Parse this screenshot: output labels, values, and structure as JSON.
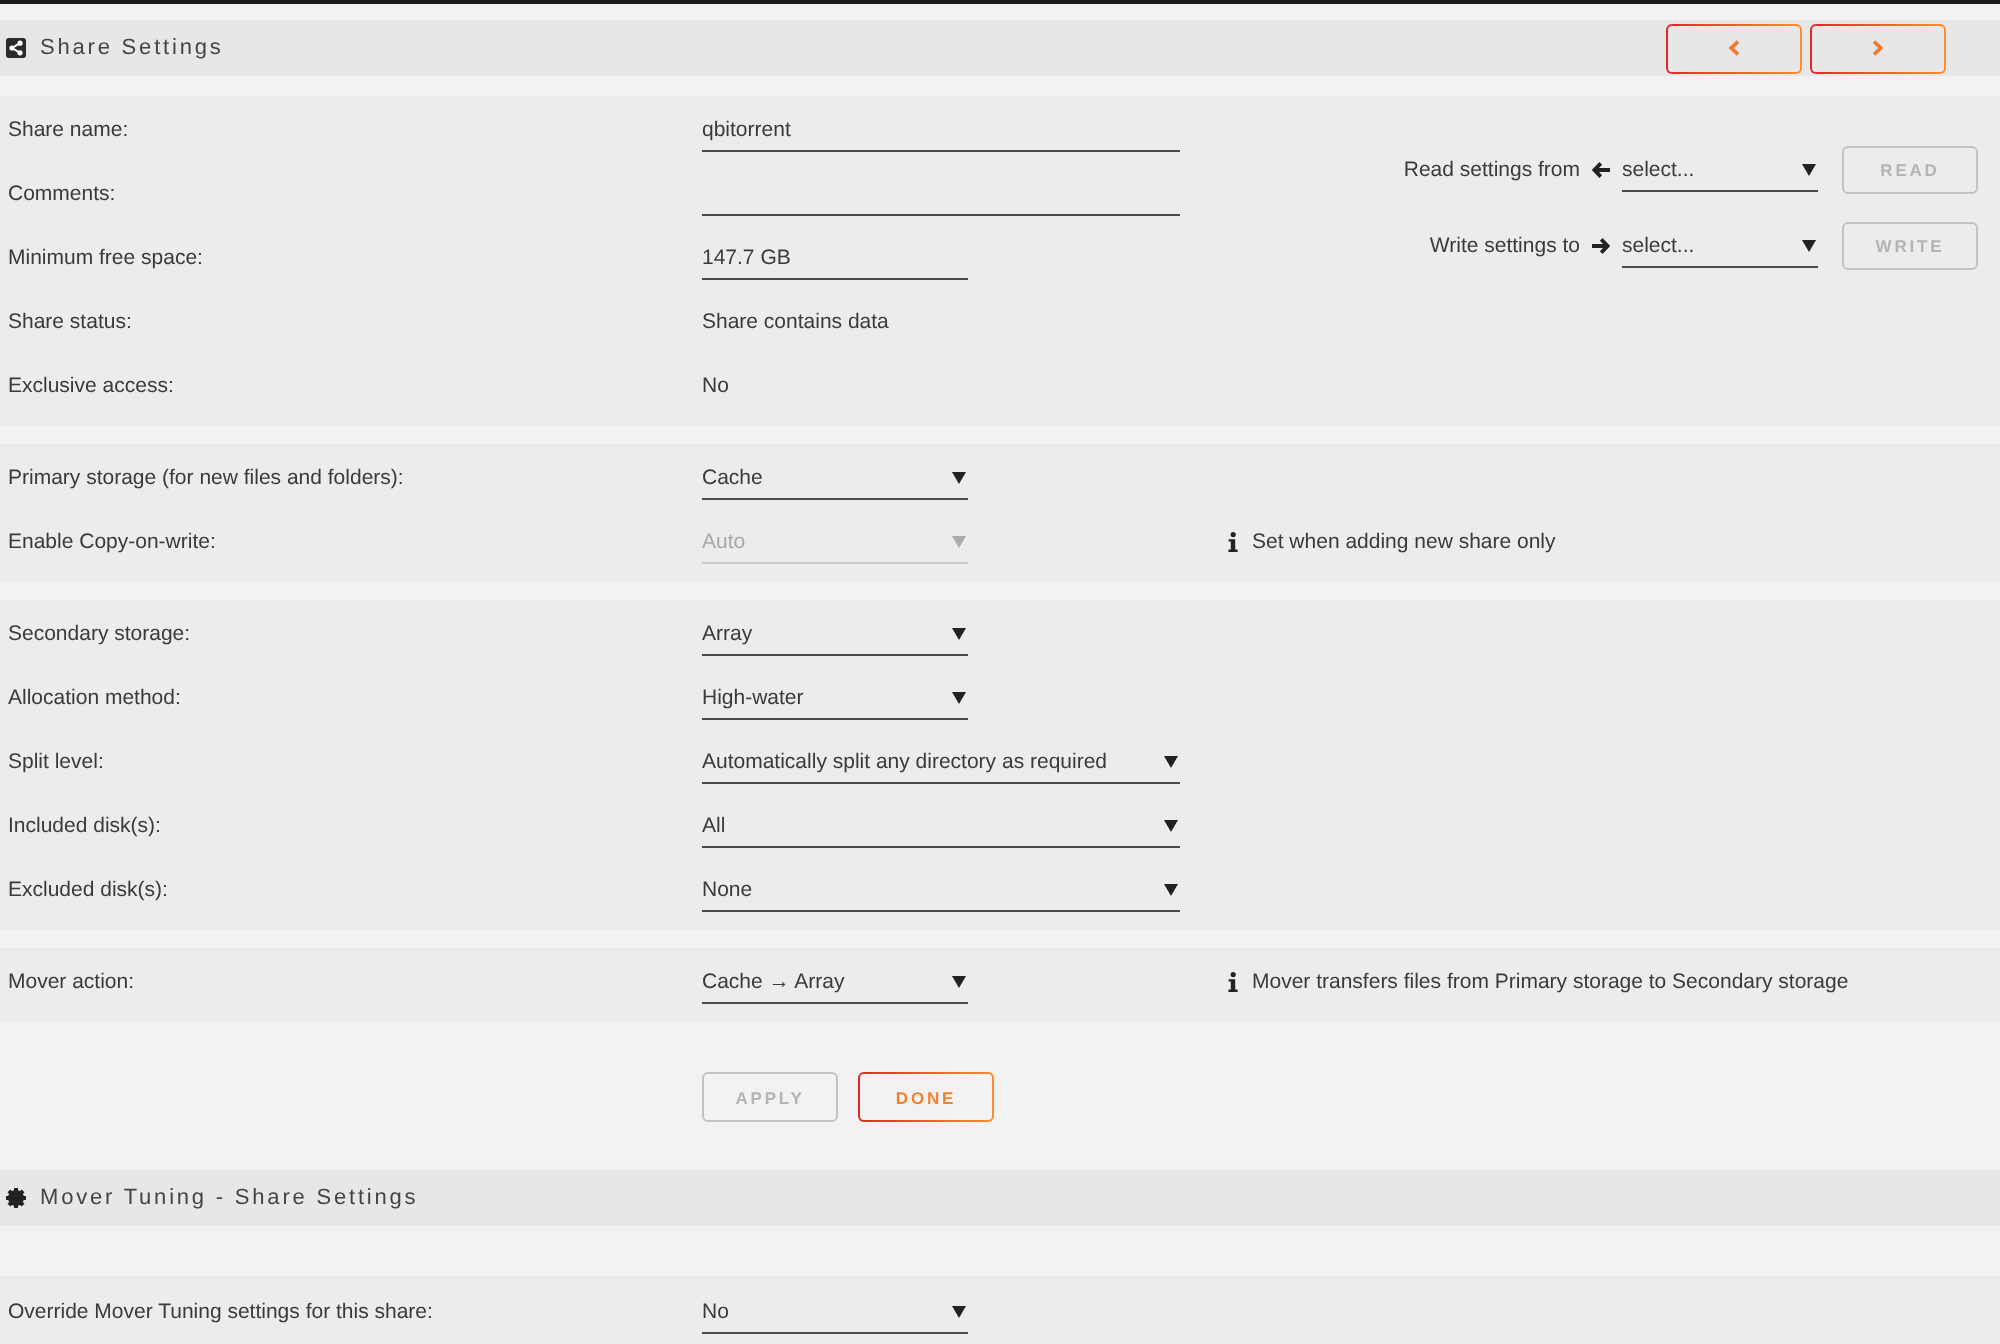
{
  "share_settings": {
    "title": "Share Settings",
    "nav_buttons": [
      {
        "kind": "previous"
      },
      {
        "kind": "next"
      }
    ],
    "groups": [
      {
        "rows": [
          {
            "label": "Share name:",
            "kind": "input",
            "value": "qbitorrent",
            "wide": true
          },
          {
            "label": "Comments:",
            "kind": "input",
            "wide": true
          },
          {
            "label": "Minimum free space:",
            "kind": "input",
            "value": "147.7 GB",
            "wide": false
          },
          {
            "label": "Share status:",
            "kind": "text",
            "value": "Share contains data"
          },
          {
            "label": "Exclusive access:",
            "kind": "text",
            "value": "No"
          }
        ],
        "transfer": [
          {
            "kind": "read",
            "label": "Read settings from",
            "value": "select...",
            "button": "READ",
            "disabled": true
          },
          {
            "kind": "write",
            "label": "Write settings to",
            "value": "select...",
            "button": "WRITE",
            "disabled": true
          }
        ]
      },
      {
        "rows": [
          {
            "label": "Primary storage (for new files and folders):",
            "kind": "select",
            "value": "Cache",
            "wide": false,
            "disabled": false
          },
          {
            "label": "Enable Copy-on-write:",
            "kind": "select",
            "value": "Auto",
            "wide": false,
            "disabled": true,
            "note": "Set when adding new share only"
          }
        ]
      },
      {
        "rows": [
          {
            "label": "Secondary storage:",
            "kind": "select",
            "value": "Array",
            "wide": false,
            "disabled": false
          },
          {
            "label": "Allocation method:",
            "kind": "select",
            "value": "High-water",
            "wide": false,
            "disabled": false
          },
          {
            "label": "Split level:",
            "kind": "select",
            "value": "Automatically split any directory as required",
            "wide": true,
            "disabled": false
          },
          {
            "label": "Included disk(s):",
            "kind": "select",
            "value": "All",
            "wide": true,
            "disabled": false
          },
          {
            "label": "Excluded disk(s):",
            "kind": "select",
            "value": "None",
            "wide": true,
            "disabled": false
          }
        ]
      },
      {
        "rows": [
          {
            "label": "Mover action:",
            "kind": "select",
            "value": "Cache → Array",
            "wide": false,
            "disabled": false,
            "note": "Mover transfers files from Primary storage to Secondary storage"
          }
        ]
      }
    ],
    "actions": [
      {
        "label": "APPLY",
        "disabled": true
      },
      {
        "label": "DONE",
        "disabled": false
      }
    ]
  },
  "mover_tuning": {
    "title": "Mover Tuning - Share Settings",
    "rows": [
      {
        "label": "Override Mover Tuning settings for this share:",
        "kind": "select",
        "value": "No",
        "wide": false,
        "disabled": false
      }
    ]
  }
}
